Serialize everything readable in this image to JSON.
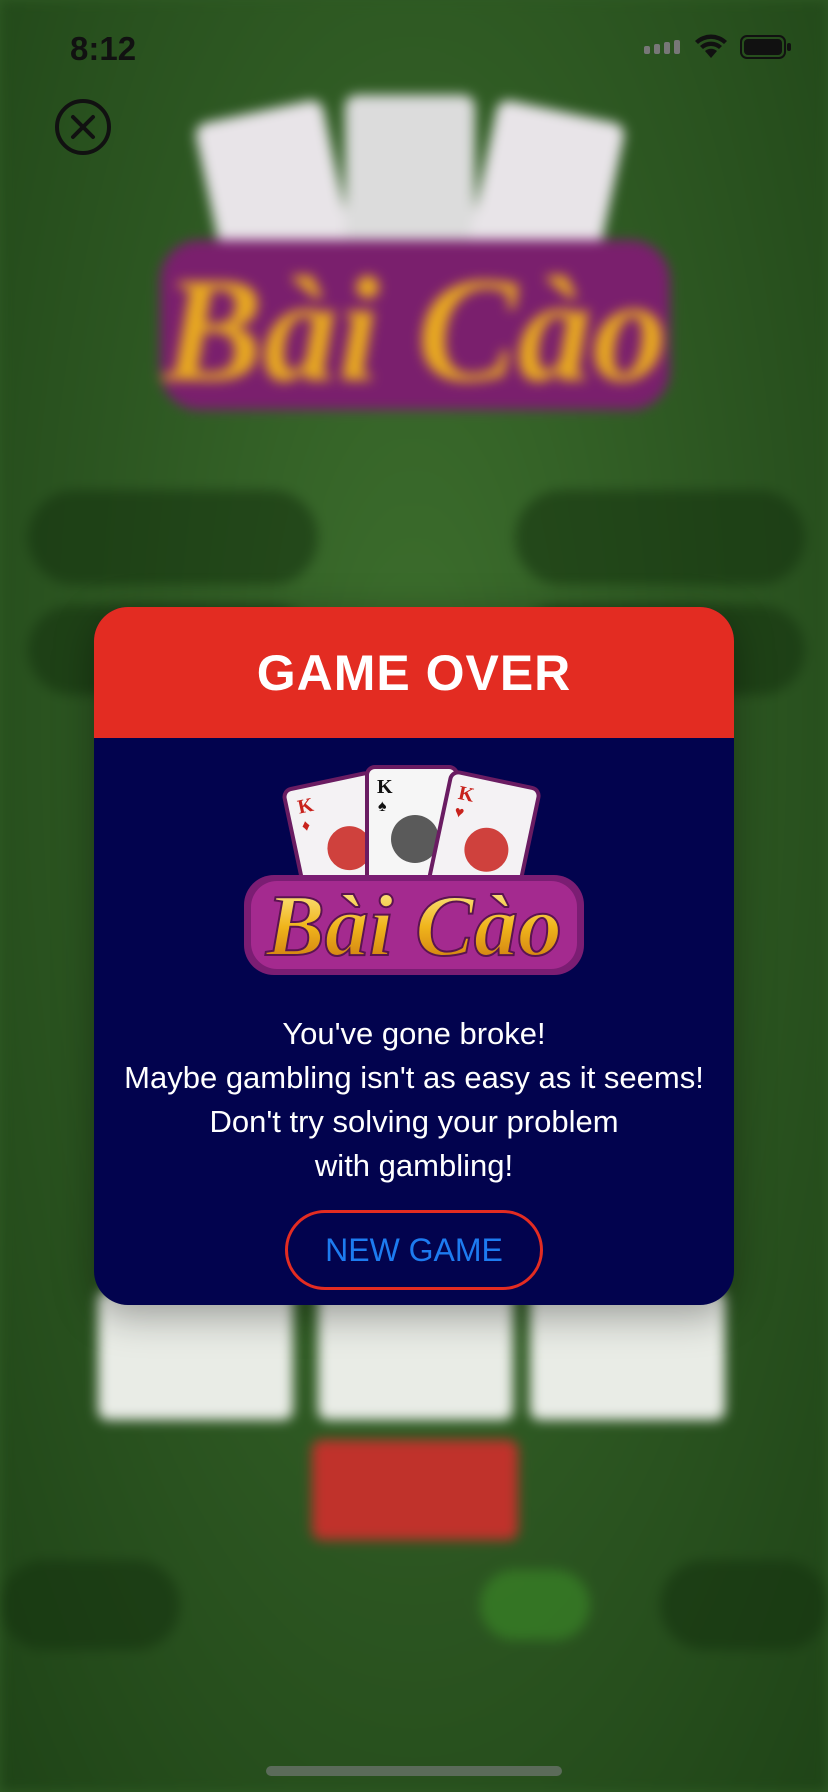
{
  "status_bar": {
    "time": "8:12"
  },
  "dialog": {
    "title": "GAME OVER",
    "logo_text": "Bài Cào",
    "message_lines": [
      "You've gone broke!",
      "Maybe gambling isn't as easy as it seems!",
      "Don't try solving your problem",
      "with gambling!"
    ],
    "new_game_label": "NEW GAME"
  },
  "colors": {
    "header_red": "#e32c22",
    "dialog_navy": "#02034e",
    "button_text_blue": "#1d7bf0",
    "table_green": "#2f5a24"
  },
  "icons": {
    "close": "close-icon",
    "wifi": "wifi-icon",
    "battery": "battery-icon",
    "cellular": "cellular-icon"
  }
}
